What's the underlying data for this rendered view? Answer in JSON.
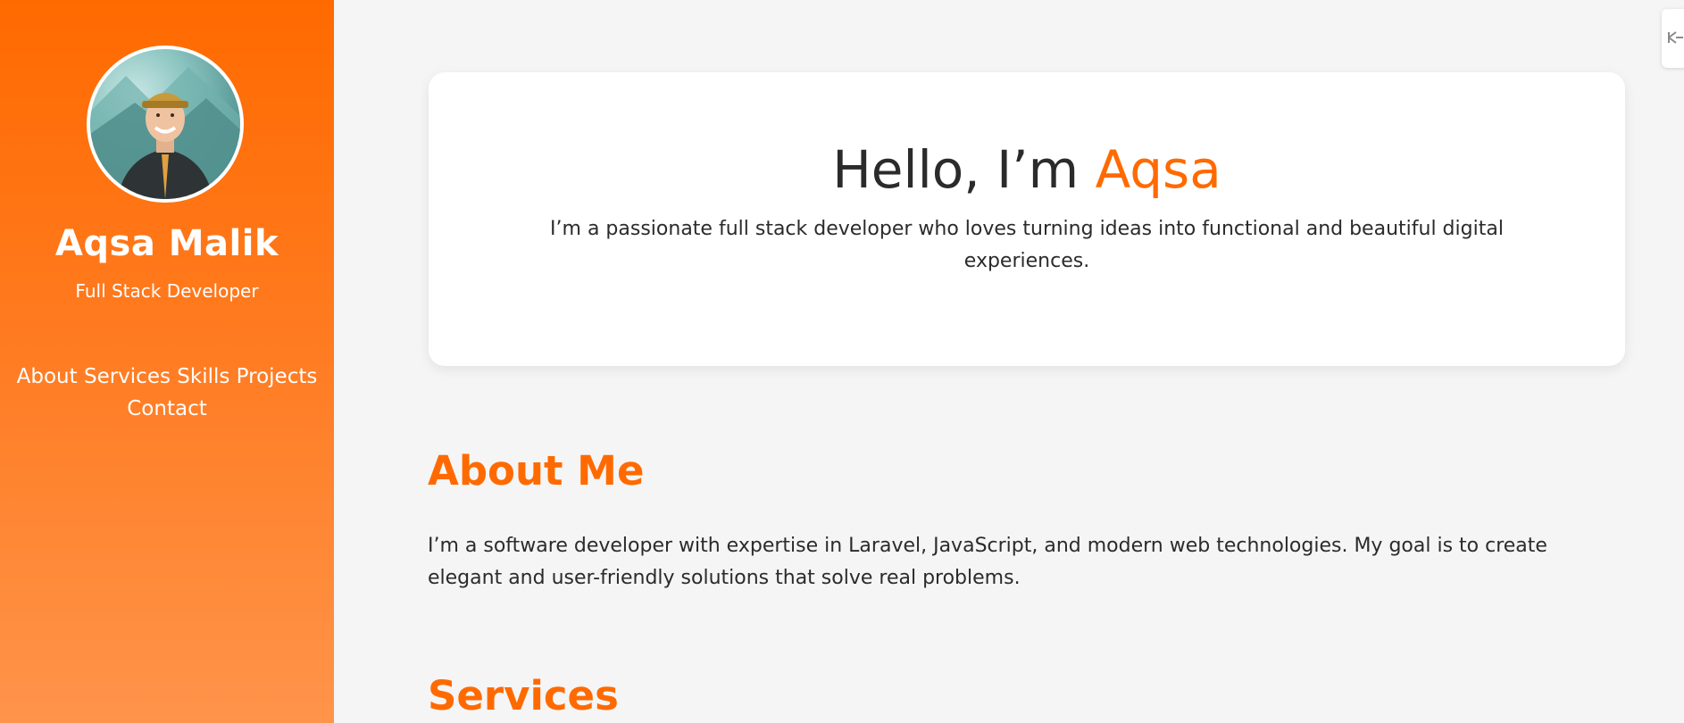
{
  "sidebar": {
    "name": "Aqsa Malik",
    "role": "Full Stack Developer",
    "nav": [
      "About",
      "Services",
      "Skills",
      "Projects",
      "Contact"
    ],
    "avatar_icon": "profile-photo"
  },
  "hero": {
    "greeting": "Hello, I’m",
    "highlight_name": "Aqsa",
    "description": "I’m a passionate full stack developer who loves turning ideas into functional and beautiful digital experiences."
  },
  "about": {
    "title": "About Me",
    "text": "I’m a software developer with expertise in Laravel, JavaScript, and modern web technologies. My goal is to create elegant and user-friendly solutions that solve real problems."
  },
  "services": {
    "title": "Services"
  },
  "colors": {
    "accent": "#ff6a00",
    "sidebar_top": "#ff6a00",
    "sidebar_bottom": "#ff944a",
    "background": "#f5f5f5",
    "text": "#2b2b2b"
  },
  "widget_icon": "extension-icon"
}
